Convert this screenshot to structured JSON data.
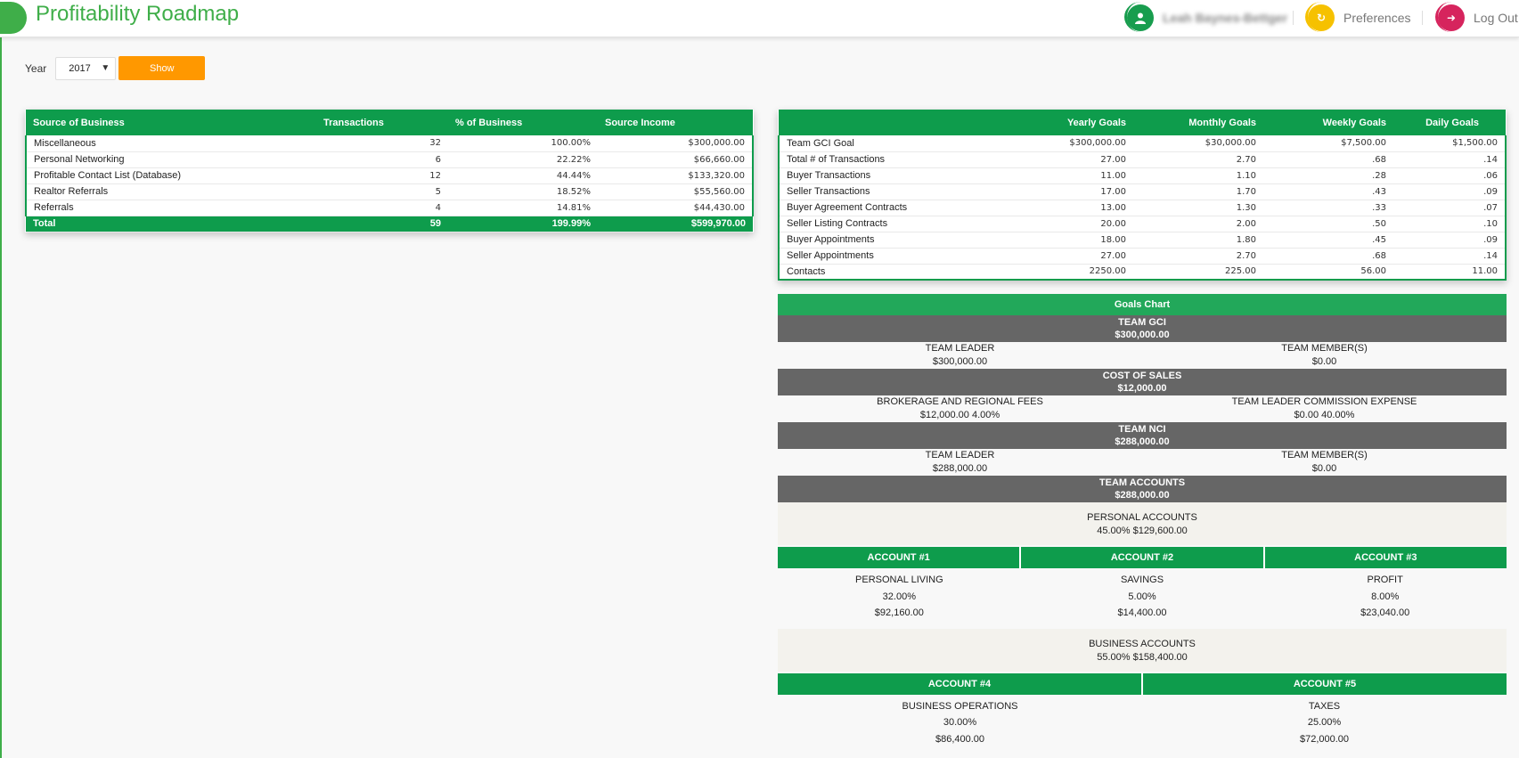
{
  "header": {
    "title": "Profitability Roadmap",
    "user_name": "Leah Baynes-Bettger",
    "preferences": "Preferences",
    "logout": "Log Out"
  },
  "filter": {
    "year_label": "Year",
    "year_value": "2017",
    "show_label": "Show"
  },
  "source_table": {
    "headers": [
      "Source of Business",
      "Transactions",
      "% of Business",
      "Source Income"
    ],
    "rows": [
      {
        "source": "Miscellaneous",
        "transactions": "32",
        "percent": "100.00%",
        "income": "$300,000.00"
      },
      {
        "source": "Personal Networking",
        "transactions": "6",
        "percent": "22.22%",
        "income": "$66,660.00"
      },
      {
        "source": "Profitable Contact List (Database)",
        "transactions": "12",
        "percent": "44.44%",
        "income": "$133,320.00"
      },
      {
        "source": "Realtor Referrals",
        "transactions": "5",
        "percent": "18.52%",
        "income": "$55,560.00"
      },
      {
        "source": "Referrals",
        "transactions": "4",
        "percent": "14.81%",
        "income": "$44,430.00"
      }
    ],
    "total": {
      "label": "Total",
      "transactions": "59",
      "percent": "199.99%",
      "income": "$599,970.00"
    }
  },
  "goals_table": {
    "headers": [
      "",
      "Yearly Goals",
      "Monthly Goals",
      "Weekly Goals",
      "Daily Goals"
    ],
    "rows": [
      {
        "name": "Team GCI Goal",
        "yearly": "$300,000.00",
        "monthly": "$30,000.00",
        "weekly": "$7,500.00",
        "daily": "$1,500.00"
      },
      {
        "name": "Total # of Transactions",
        "yearly": "27.00",
        "monthly": "2.70",
        "weekly": ".68",
        "daily": ".14"
      },
      {
        "name": "Buyer Transactions",
        "yearly": "11.00",
        "monthly": "1.10",
        "weekly": ".28",
        "daily": ".06"
      },
      {
        "name": "Seller Transactions",
        "yearly": "17.00",
        "monthly": "1.70",
        "weekly": ".43",
        "daily": ".09"
      },
      {
        "name": "Buyer Agreement Contracts",
        "yearly": "13.00",
        "monthly": "1.30",
        "weekly": ".33",
        "daily": ".07"
      },
      {
        "name": "Seller Listing Contracts",
        "yearly": "20.00",
        "monthly": "2.00",
        "weekly": ".50",
        "daily": ".10"
      },
      {
        "name": "Buyer Appointments",
        "yearly": "18.00",
        "monthly": "1.80",
        "weekly": ".45",
        "daily": ".09"
      },
      {
        "name": "Seller Appointments",
        "yearly": "27.00",
        "monthly": "2.70",
        "weekly": ".68",
        "daily": ".14"
      },
      {
        "name": "Contacts",
        "yearly": "2250.00",
        "monthly": "225.00",
        "weekly": "56.00",
        "daily": "11.00"
      }
    ]
  },
  "goals_chart": {
    "title": "Goals Chart",
    "team_gci": {
      "label": "TEAM GCI",
      "value": "$300,000.00"
    },
    "gci_split": [
      {
        "label": "TEAM LEADER",
        "value": "$300,000.00"
      },
      {
        "label": "TEAM MEMBER(S)",
        "value": "$0.00"
      }
    ],
    "cost_of_sales": {
      "label": "COST OF SALES",
      "value": "$12,000.00"
    },
    "cost_split": [
      {
        "label": "BROKERAGE AND REGIONAL FEES",
        "value": "$12,000.00 4.00%"
      },
      {
        "label": "TEAM LEADER COMMISSION EXPENSE",
        "value": "$0.00 40.00%"
      }
    ],
    "team_nci": {
      "label": "TEAM NCI",
      "value": "$288,000.00"
    },
    "nci_split": [
      {
        "label": "TEAM LEADER",
        "value": "$288,000.00"
      },
      {
        "label": "TEAM MEMBER(S)",
        "value": "$0.00"
      }
    ],
    "team_accounts": {
      "label": "TEAM ACCOUNTS",
      "value": "$288,000.00"
    },
    "personal_accounts": {
      "label": "PERSONAL ACCOUNTS",
      "value": "45.00% $129,600.00"
    },
    "personal_list": [
      {
        "head": "ACCOUNT #1",
        "name": "PERSONAL LIVING",
        "percent": "32.00%",
        "amount": "$92,160.00"
      },
      {
        "head": "ACCOUNT #2",
        "name": "SAVINGS",
        "percent": "5.00%",
        "amount": "$14,400.00"
      },
      {
        "head": "ACCOUNT #3",
        "name": "PROFIT",
        "percent": "8.00%",
        "amount": "$23,040.00"
      }
    ],
    "business_accounts": {
      "label": "BUSINESS ACCOUNTS",
      "value": "55.00% $158,400.00"
    },
    "business_list": [
      {
        "head": "ACCOUNT #4",
        "name": "BUSINESS OPERATIONS",
        "percent": "30.00%",
        "amount": "$86,400.00"
      },
      {
        "head": "ACCOUNT #5",
        "name": "TAXES",
        "percent": "25.00%",
        "amount": "$72,000.00"
      }
    ]
  }
}
